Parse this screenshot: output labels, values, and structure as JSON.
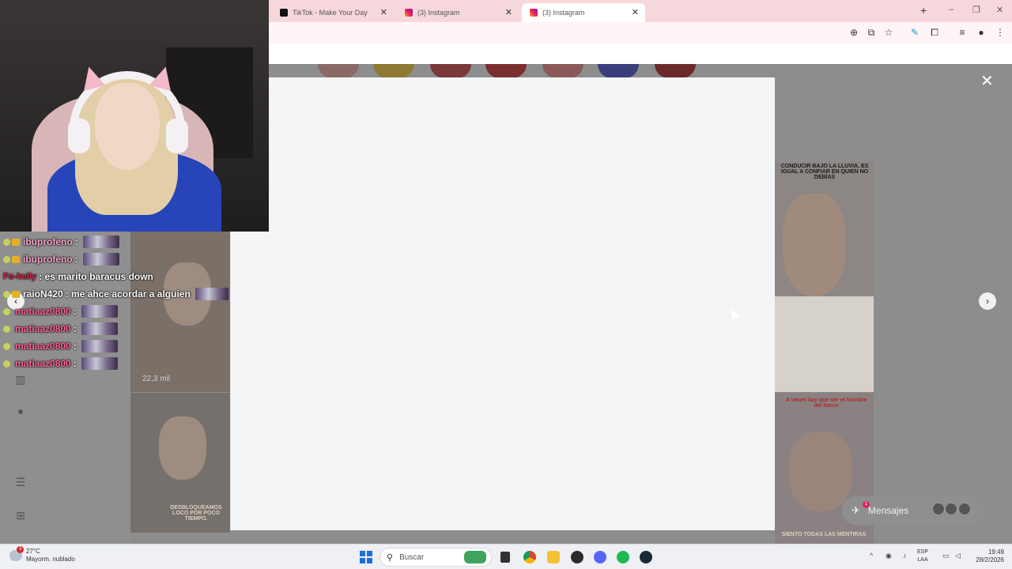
{
  "browser": {
    "tabs": [
      {
        "label": "TikTok - Make Your Day",
        "icon": "tiktok-icon",
        "active": false
      },
      {
        "label": "(3) Instagram",
        "icon": "instagram-icon",
        "active": false
      },
      {
        "label": "(3) Instagram",
        "icon": "instagram-icon",
        "active": true
      }
    ],
    "new_tab": "+",
    "window_controls": {
      "minimize": "–",
      "restore": "❐",
      "close": "✕"
    },
    "toolbar_icons": [
      "zoom-icon",
      "cast-icon",
      "bookmark-star-icon",
      "translate-icon",
      "extensions-icon",
      "tab-search-icon",
      "profile-icon",
      "menu-dots-icon"
    ]
  },
  "instagram": {
    "close_label": "✕",
    "views_count": "22,3 mil",
    "thumb_captions": {
      "top_right": "CONDUCIR BAJO LA LLUVIA, ES IGUAL A CONFIAR EN QUIEN NO DEBÍAS",
      "bottom_left": "DESBLOQUEAMOS LOCO POR POCO TIEMPO.",
      "bottom_right_top": "A veces hay que ser el hombre del barco",
      "bottom_right_bottom": "SIENTO TODAS LAS MENTIRAS"
    },
    "messages": {
      "label": "Mensajes",
      "badge": "1"
    }
  },
  "chat": {
    "lines": [
      {
        "user": "ibuprofeno",
        "sep": ":",
        "message": "",
        "emote": true,
        "user_color": "#f5a3c8"
      },
      {
        "user": "ibuprofeno",
        "sep": ":",
        "message": "",
        "emote": true,
        "user_color": "#f5a3c8"
      },
      {
        "user": "Fo-kuiiy",
        "sep": ":",
        "message": "es marito baracus down",
        "emote": false,
        "user_color": "#d8204a"
      },
      {
        "user": "raioN420",
        "sep": ":",
        "message": "me ahce acordar a alguien",
        "emote": true,
        "user_color": "#ffffff"
      },
      {
        "user": "matiaaz0800",
        "sep": ":",
        "message": "",
        "emote": true,
        "user_color": "#ff5f9a"
      },
      {
        "user": "matiaaz0800",
        "sep": ":",
        "message": "",
        "emote": true,
        "user_color": "#ff5f9a"
      },
      {
        "user": "matiaaz0800",
        "sep": ":",
        "message": "",
        "emote": true,
        "user_color": "#ff5f9a"
      },
      {
        "user": "matiaaz0800",
        "sep": ":",
        "message": "",
        "emote": true,
        "user_color": "#ff5f9a"
      }
    ]
  },
  "taskbar": {
    "weather": {
      "temp": "27°C",
      "desc": "Mayorm. nublado",
      "badge": "3"
    },
    "search_placeholder": "Buscar",
    "apps": [
      "file-explorer-icon",
      "chrome-icon",
      "folder-icon",
      "obs-icon",
      "discord-icon",
      "spotify-icon",
      "steam-icon"
    ],
    "lang": {
      "line1": "ESP",
      "line2": "LAA"
    },
    "clock": {
      "time": "19:49",
      "date": "28/2/2026"
    }
  }
}
